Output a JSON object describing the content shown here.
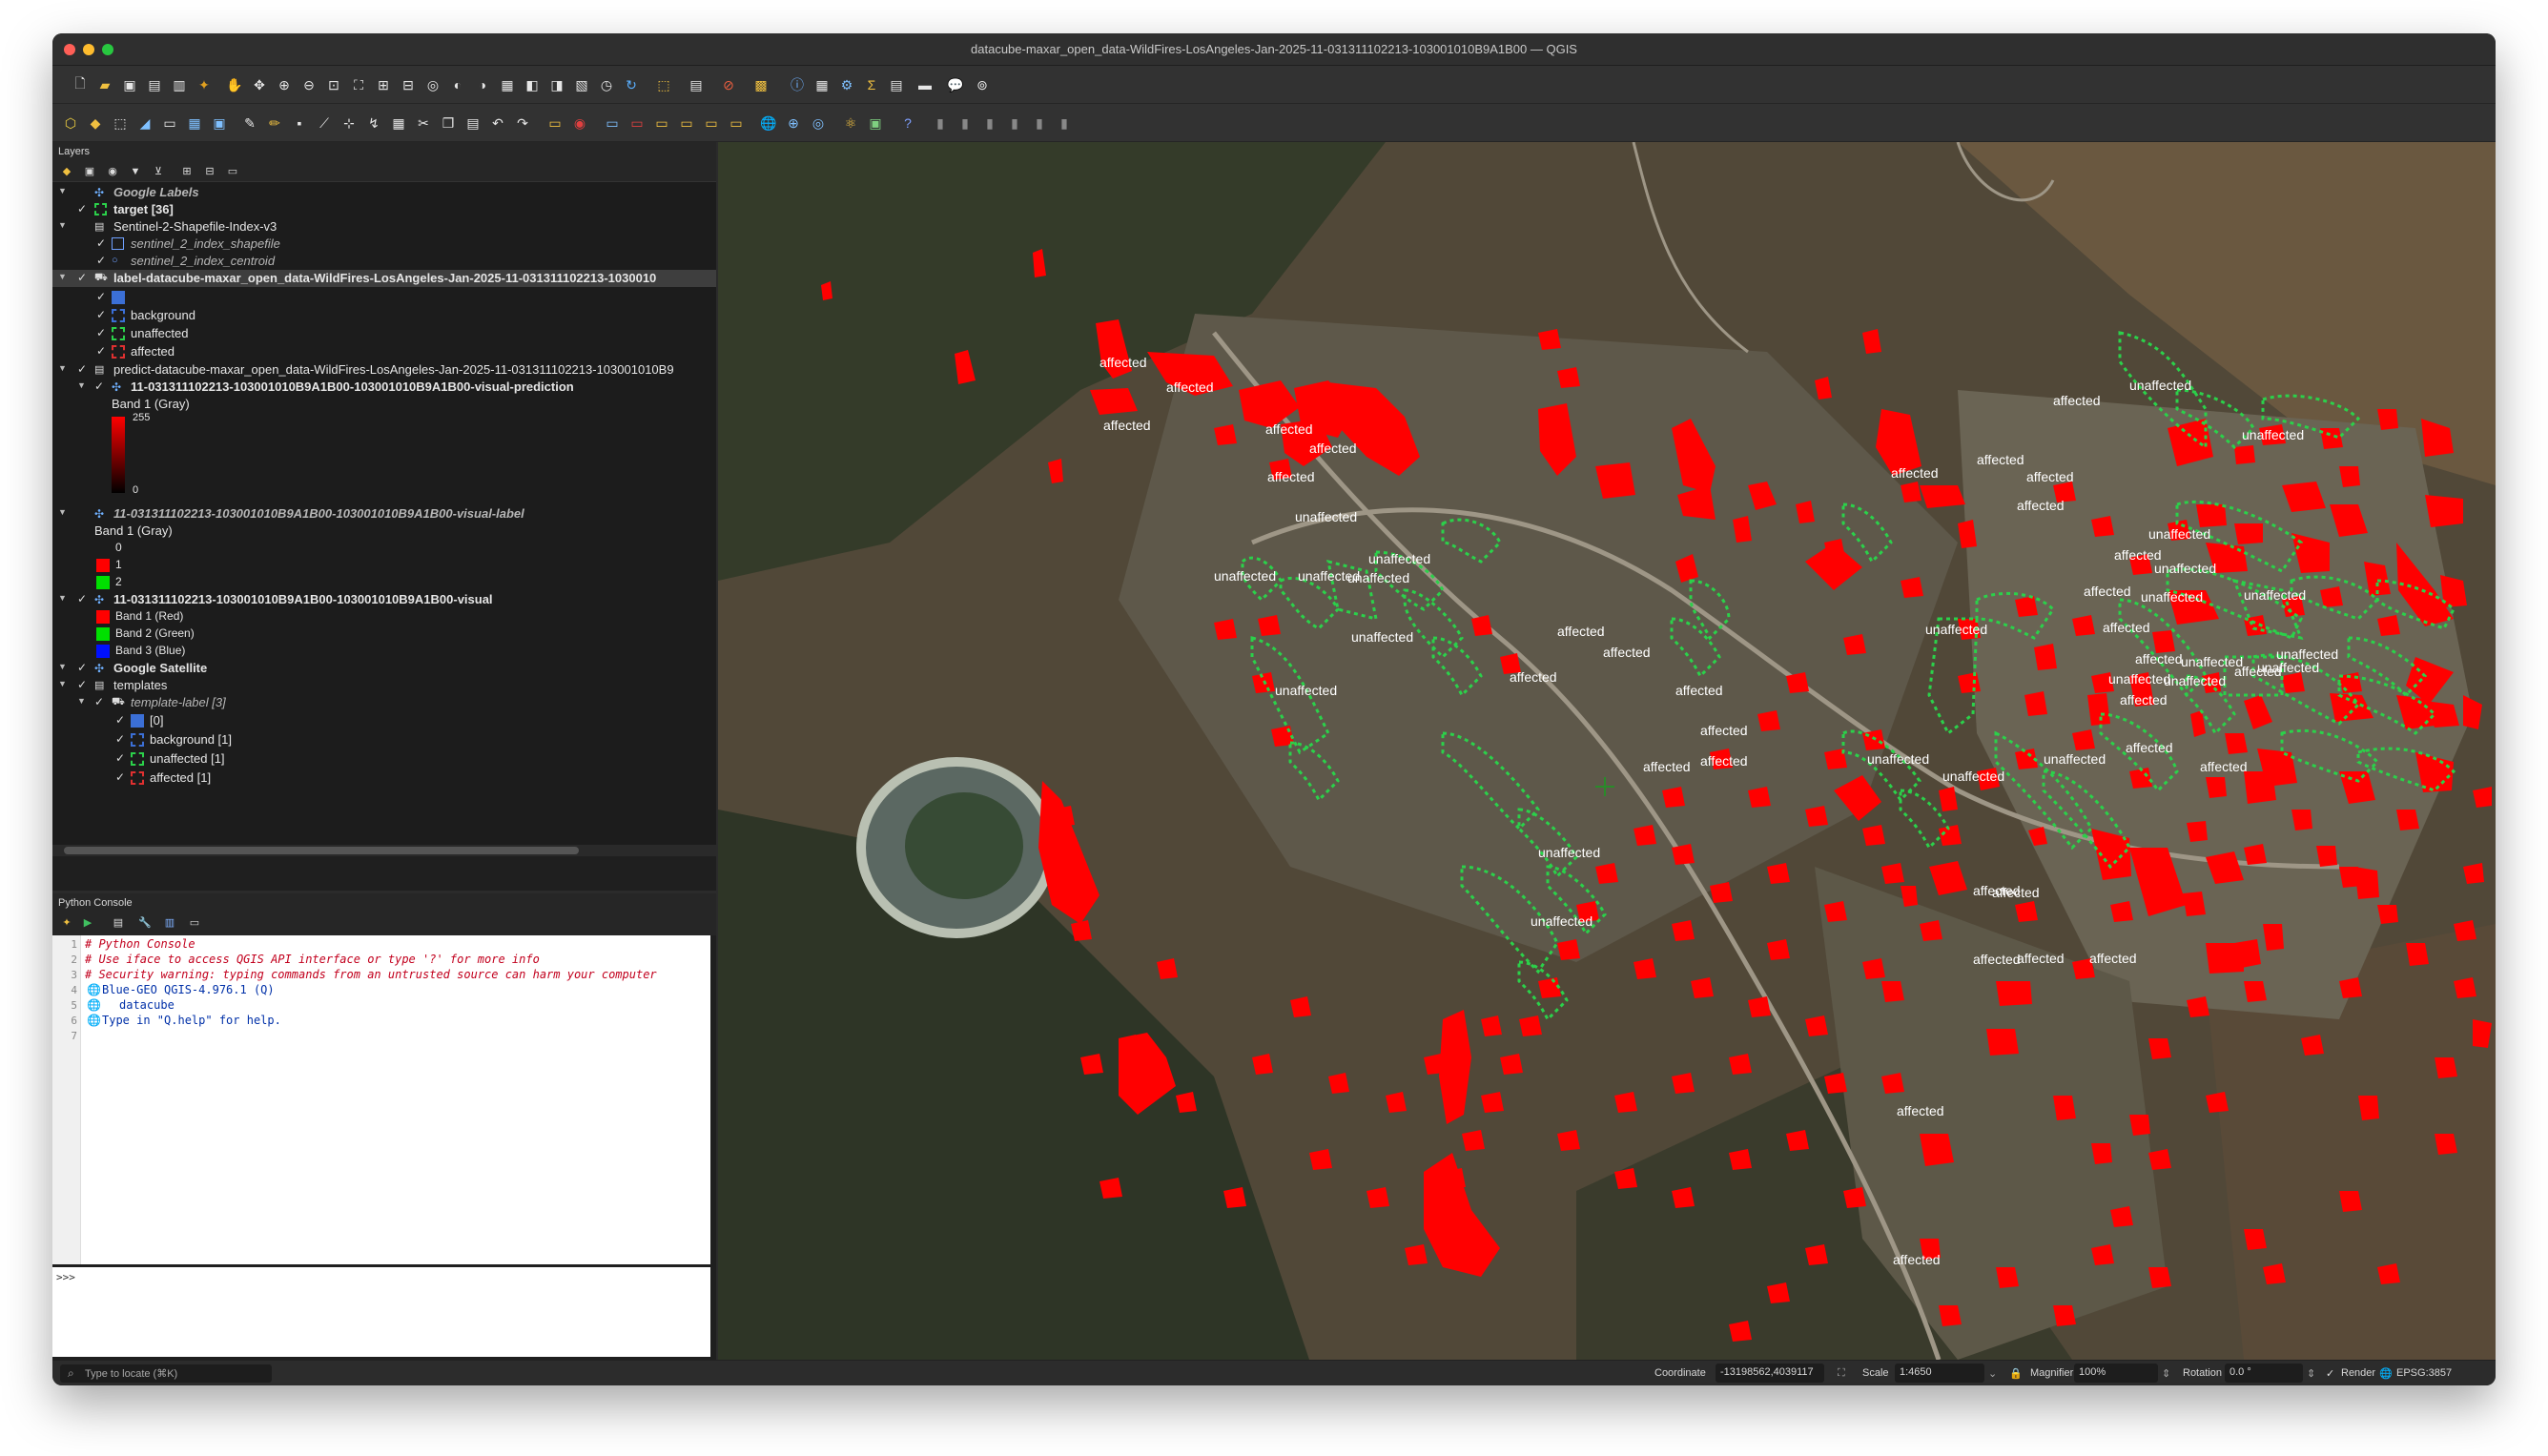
{
  "window": {
    "title": "datacube-maxar_open_data-WildFires-LosAngeles-Jan-2025-11-031311102213-103001010B9A1B00 — QGIS"
  },
  "layers_panel": {
    "title": "Layers",
    "rows": [
      {
        "label": "Google Labels"
      },
      {
        "label": "target [36]"
      },
      {
        "label": "Sentinel-2-Shapefile-Index-v3"
      },
      {
        "label": "sentinel_2_index_shapefile"
      },
      {
        "label": "sentinel_2_index_centroid"
      },
      {
        "label": "label-datacube-maxar_open_data-WildFires-LosAngeles-Jan-2025-11-031311102213-1030010"
      },
      {
        "label": "background"
      },
      {
        "label": "unaffected"
      },
      {
        "label": "affected"
      },
      {
        "label": "predict-datacube-maxar_open_data-WildFires-LosAngeles-Jan-2025-11-031311102213-103001010B9"
      },
      {
        "label": "11-031311102213-103001010B9A1B00-103001010B9A1B00-visual-prediction"
      },
      {
        "label": "Band 1 (Gray)"
      },
      {
        "label": "255"
      },
      {
        "label": "0"
      },
      {
        "label": "11-031311102213-103001010B9A1B00-103001010B9A1B00-visual-label"
      },
      {
        "label": "Band 1 (Gray)"
      },
      {
        "label": "0"
      },
      {
        "label": "1"
      },
      {
        "label": "2"
      },
      {
        "label": "11-031311102213-103001010B9A1B00-103001010B9A1B00-visual"
      },
      {
        "label": "Band 1 (Red)"
      },
      {
        "label": "Band 2 (Green)"
      },
      {
        "label": "Band 3 (Blue)"
      },
      {
        "label": "Google Satellite"
      },
      {
        "label": "templates"
      },
      {
        "label": "template-label [3]"
      },
      {
        "label": "[0]"
      },
      {
        "label": "background [1]"
      },
      {
        "label": "unaffected [1]"
      },
      {
        "label": "affected [1]"
      }
    ]
  },
  "console": {
    "title": "Python Console",
    "lines": [
      {
        "n": "1",
        "text": "# Python Console"
      },
      {
        "n": "2",
        "text": "# Use iface to access QGIS API interface or type '?' for more info"
      },
      {
        "n": "3",
        "text": "# Security warning: typing commands from an untrusted source can harm your computer"
      },
      {
        "n": "4",
        "text": "Blue-GEO QGIS-4.976.1 (Q)"
      },
      {
        "n": "5",
        "text": "datacube"
      },
      {
        "n": "6",
        "text": "Type in \"Q.help\" for help."
      },
      {
        "n": "7",
        "text": ""
      }
    ],
    "prompt": ">>>"
  },
  "map": {
    "labels": {
      "affected": "affected",
      "unaffected": "unaffected"
    }
  },
  "status": {
    "locator_placeholder": "Type to locate (⌘K)",
    "coordinate_label": "Coordinate",
    "coordinate_value": "-13198562,4039117",
    "scale_label": "Scale",
    "scale_value": "1:4650",
    "magnifier_label": "Magnifier",
    "magnifier_value": "100%",
    "rotation_label": "Rotation",
    "rotation_value": "0.0 °",
    "render_label": "Render",
    "crs": "EPSG:3857"
  },
  "colors": {
    "affected": "#ff0000",
    "unaffected": "#2bd14a",
    "background": "#3b6fd6"
  }
}
